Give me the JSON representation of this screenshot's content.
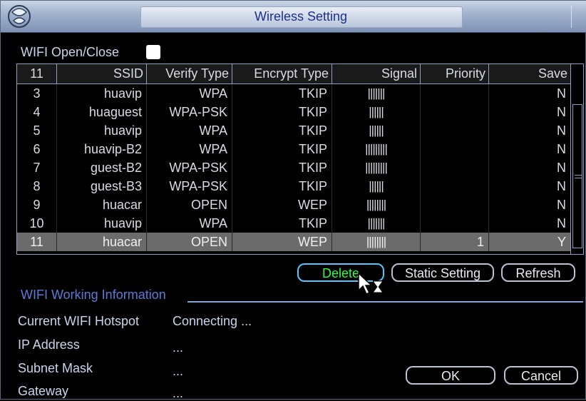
{
  "window": {
    "title": "Wireless Setting"
  },
  "wifi": {
    "open_close_label": "WIFI Open/Close",
    "enabled": false
  },
  "table": {
    "columns": [
      "11",
      "SSID",
      "Verify Type",
      "Encrypt Type",
      "Signal",
      "Priority",
      "Save"
    ],
    "rows": [
      {
        "no": "3",
        "ssid": "huavip",
        "verify": "WPA",
        "encrypt": "TKIP",
        "signal": "|||||||",
        "priority": "",
        "save": "N"
      },
      {
        "no": "4",
        "ssid": "huaguest",
        "verify": "WPA-PSK",
        "encrypt": "TKIP",
        "signal": "||||||",
        "priority": "",
        "save": "N"
      },
      {
        "no": "5",
        "ssid": "huavip",
        "verify": "WPA",
        "encrypt": "TKIP",
        "signal": "||||||",
        "priority": "",
        "save": "N"
      },
      {
        "no": "6",
        "ssid": "huavip-B2",
        "verify": "WPA",
        "encrypt": "TKIP",
        "signal": "|||||||||",
        "priority": "",
        "save": "N"
      },
      {
        "no": "7",
        "ssid": "guest-B2",
        "verify": "WPA-PSK",
        "encrypt": "TKIP",
        "signal": "|||||||||",
        "priority": "",
        "save": "N"
      },
      {
        "no": "8",
        "ssid": "guest-B3",
        "verify": "WPA-PSK",
        "encrypt": "TKIP",
        "signal": "||||||",
        "priority": "",
        "save": "N"
      },
      {
        "no": "9",
        "ssid": "huacar",
        "verify": "OPEN",
        "encrypt": "WEP",
        "signal": "||||||||",
        "priority": "",
        "save": "N"
      },
      {
        "no": "10",
        "ssid": "huavip",
        "verify": "WPA",
        "encrypt": "TKIP",
        "signal": "|||||||",
        "priority": "",
        "save": "N"
      },
      {
        "no": "11",
        "ssid": "huacar",
        "verify": "OPEN",
        "encrypt": "WEP",
        "signal": "||||||||",
        "priority": "1",
        "save": "Y",
        "selected": true
      }
    ]
  },
  "buttons": {
    "delete": "Delete",
    "static_setting": "Static Setting",
    "refresh": "Refresh",
    "ok": "OK",
    "cancel": "Cancel"
  },
  "info": {
    "section_title": "WIFI Working Information",
    "current_hotspot_label": "Current WIFI Hotspot",
    "current_hotspot_value": "Connecting ...",
    "ip_label": "IP Address",
    "ip_value": "...",
    "subnet_label": "Subnet Mask",
    "subnet_value": "...",
    "gateway_label": "Gateway",
    "gateway_value": "..."
  },
  "colors": {
    "accent_blue": "#5b7bd6",
    "focus_text": "#2fff3a",
    "selected_row": "#6b6b6b"
  },
  "icons": [
    "app-logo-icon",
    "mouse-cursor-icon",
    "hourglass-icon"
  ]
}
